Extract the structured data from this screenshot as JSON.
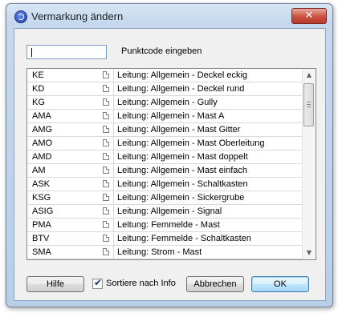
{
  "window": {
    "title": "Vermarkung ändern",
    "close_symbol": "✕"
  },
  "input": {
    "value": "",
    "label": "Punktcode eingeben"
  },
  "list": {
    "rows": [
      {
        "code": "KE",
        "description": "Leitung: Allgemein - Deckel eckig"
      },
      {
        "code": "KD",
        "description": "Leitung: Allgemein - Deckel rund"
      },
      {
        "code": "KG",
        "description": "Leitung: Allgemein - Gully"
      },
      {
        "code": "AMA",
        "description": "Leitung: Allgemein - Mast A"
      },
      {
        "code": "AMG",
        "description": "Leitung: Allgemein - Mast Gitter"
      },
      {
        "code": "AMO",
        "description": "Leitung: Allgemein - Mast Oberleitung"
      },
      {
        "code": "AMD",
        "description": "Leitung: Allgemein - Mast doppelt"
      },
      {
        "code": "AM",
        "description": "Leitung: Allgemein - Mast einfach"
      },
      {
        "code": "ASK",
        "description": "Leitung: Allgemein - Schaltkasten"
      },
      {
        "code": "KSG",
        "description": "Leitung: Allgemein - Sickergrube"
      },
      {
        "code": "ASIG",
        "description": "Leitung: Allgemein - Signal"
      },
      {
        "code": "PMA",
        "description": "Leitung: Femmelde - Mast"
      },
      {
        "code": "BTV",
        "description": "Leitung: Femmelde - Schaltkasten"
      },
      {
        "code": "SMA",
        "description": "Leitung: Strom - Mast"
      }
    ],
    "scroll_up_symbol": "▲",
    "scroll_down_symbol": "▼"
  },
  "footer": {
    "help_label": "Hilfe",
    "sort_label": "Sortiere nach Info",
    "sort_checked": true,
    "cancel_label": "Abbrechen",
    "ok_label": "OK"
  },
  "colors": {
    "title_bar": "#c5d8ee",
    "client": "#f0f0f0",
    "close_button": "#c9503f",
    "ok_border": "#3c7fb1"
  }
}
